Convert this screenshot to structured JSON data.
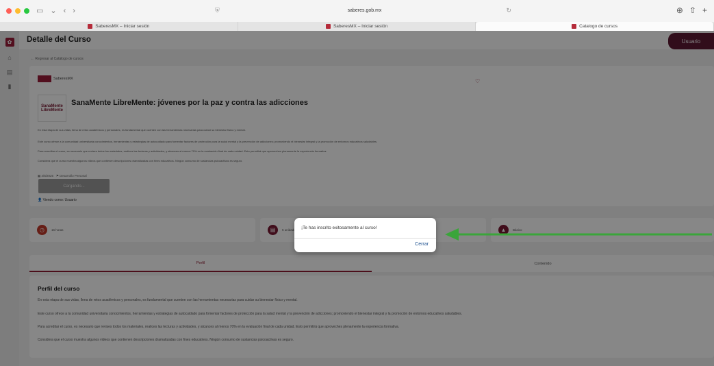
{
  "browser": {
    "address": "saberes.gob.mx",
    "tabs": [
      {
        "label": "SaberesMX – Iniciar sesión"
      },
      {
        "label": "SaberesMX – Iniciar sesión"
      },
      {
        "label": "Catalogo de cursos"
      }
    ]
  },
  "header": {
    "title": "Detalle del Curso",
    "user_label": "Usuario"
  },
  "back_link": "← Regresar al Catálogo de cursos",
  "course": {
    "brand": "SaberesMX",
    "logo_text": "SanaMente LibreMente",
    "title": "SanaMente LibreMente: jóvenes por la paz y contra las adicciones",
    "description": [
      "En esta etapa de sus vidas, llena de retos académicos y personales, es fundamental que cuenten con las herramientas necesarias para cuidar su bienestar físico y mental.",
      "Este curso ofrece a la comunidad universitaria conocimientos, herramientas y estrategias de autocuidado para fomentar factores de protección para la salud mental y la prevención de adicciones; promoviendo el bienestar integral y la promoción de entornos educativos saludables.",
      "Para acreditar el curso, es necesario que revises todos los materiales, realices las lecturas y actividades, y alcances al menos 70% en la evaluación final de cada unidad. Esto permitirá que aproveches plenamente la experiencia formativa.",
      "Considera que el curso muestra algunos videos que contienen descripciones dramatizadas con fines educativos. Ningún consumo de sustancias psicoactivas es seguro."
    ],
    "date": "4/8/2025",
    "category": "Desarrollo Personal",
    "button_label": "Cargando...",
    "viewing_as_label": "Viendo como:",
    "viewing_as_value": "Usuario"
  },
  "stats": [
    {
      "icon": "clock-icon",
      "text": "16 horas"
    },
    {
      "icon": "book-icon",
      "text": "5 unidades"
    },
    {
      "icon": "level-icon",
      "text": "Básico"
    }
  ],
  "page_tabs": [
    {
      "label": "Perfil",
      "active": true
    },
    {
      "label": "Contenido",
      "active": false
    }
  ],
  "profile": {
    "title": "Perfil del curso",
    "paragraphs": [
      "En esta etapa de sus vidas, llena de retos académicos y personales, es fundamental que cuenten con las herramientas necesarias para cuidar su bienestar físico y mental.",
      "Este curso ofrece a la comunidad universitaria conocimientos, herramientas y estrategias de autocuidado para fomentar factores de protección para la salud mental y la prevención de adicciones; promoviendo el bienestar integral y la promoción de entornos educativos saludables.",
      "Para acreditar el curso, es necesario que revises todos los materiales, realices las lecturas y actividades, y alcances al menos 70% en la evaluación final de cada unidad. Esto permitirá que aproveches plenamente la experiencia formativa.",
      "Considera que el curso muestra algunos videos que contienen descripciones dramatizadas con fines educativos. Ningún consumo de sustancias psicoactivas es seguro."
    ]
  },
  "dialog": {
    "message": "¡Te has inscrito exitosamente al curso!",
    "close_label": "Cerrar"
  },
  "colors": {
    "brand": "#9b1d3a",
    "header_user": "#5e1a33",
    "arrow": "#3aa53a",
    "link": "#1a4e8e"
  }
}
